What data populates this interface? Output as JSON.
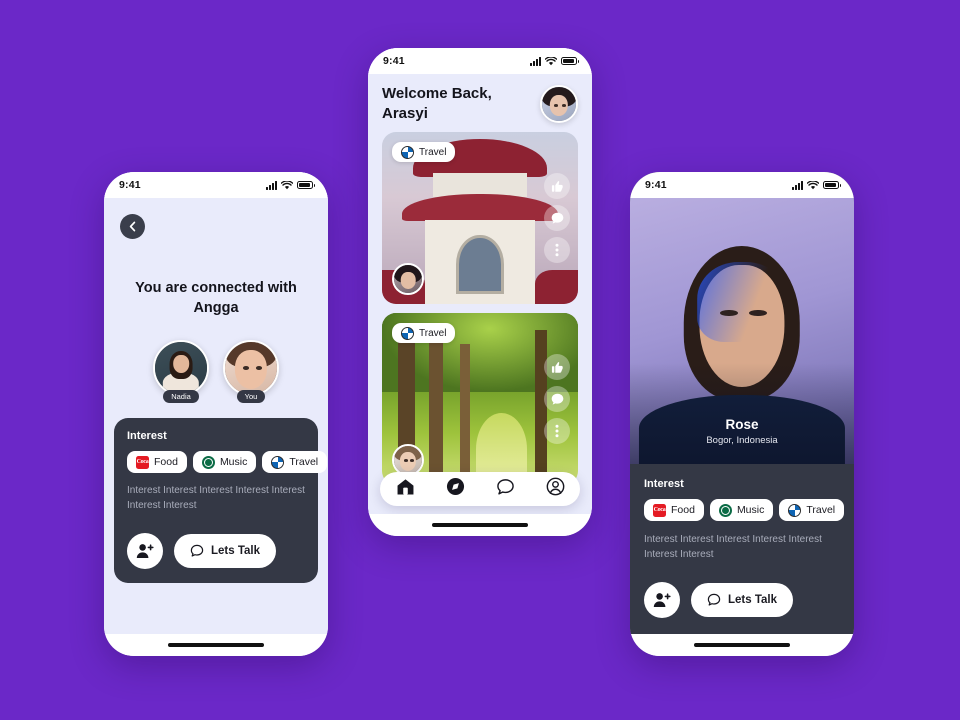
{
  "theme": {
    "background": "#6B28C8",
    "screen_bg": "#E9EBFB",
    "card_bg": "#343845",
    "chip_bg": "#FFFFFF",
    "text_dark": "#14141C",
    "text_muted": "#A9ADBB"
  },
  "status_bar": {
    "time": "9:41",
    "signal_icon": "signal-bars-icon",
    "wifi_icon": "wifi-icon",
    "battery_icon": "battery-icon"
  },
  "interest_card": {
    "title": "Interest",
    "chips": [
      {
        "label": "Food",
        "icon": "food-brand-icon"
      },
      {
        "label": "Music",
        "icon": "music-brand-icon"
      },
      {
        "label": "Travel",
        "icon": "travel-brand-icon"
      }
    ],
    "body": "Interest Interest Interest Interest Interest Interest Interest",
    "add_friend_icon": "add-person-icon",
    "talk_button": {
      "label": "Lets Talk",
      "icon": "chat-bubble-icon"
    }
  },
  "left_phone": {
    "back_icon": "chevron-left-icon",
    "title": "You are connected with Angga",
    "avatars": [
      {
        "tag": "Nadia",
        "name": "avatar-nadia"
      },
      {
        "tag": "You",
        "name": "avatar-you"
      }
    ]
  },
  "center_phone": {
    "greeting": "Welcome Back,",
    "username": "Arasyi",
    "profile_avatar": "header-avatar",
    "posts": [
      {
        "tag": {
          "label": "Travel",
          "icon": "travel-brand-icon"
        },
        "image": "pagoda-temple-photo",
        "avatar": "post-author-avatar",
        "actions": [
          {
            "name": "like-button",
            "icon": "thumbs-up-icon"
          },
          {
            "name": "comment-button",
            "icon": "comment-bubble-icon"
          },
          {
            "name": "more-button",
            "icon": "more-vertical-icon"
          }
        ]
      },
      {
        "tag": {
          "label": "Travel",
          "icon": "travel-brand-icon"
        },
        "image": "forest-path-photo",
        "avatar": "post-author-avatar",
        "actions": [
          {
            "name": "like-button",
            "icon": "thumbs-up-icon"
          },
          {
            "name": "comment-button",
            "icon": "comment-bubble-icon"
          },
          {
            "name": "more-button",
            "icon": "more-vertical-icon"
          }
        ]
      }
    ],
    "tabbar": [
      {
        "name": "tab-home",
        "icon": "home-icon",
        "active": true
      },
      {
        "name": "tab-explore",
        "icon": "compass-icon",
        "active": true
      },
      {
        "name": "tab-chat",
        "icon": "chat-icon",
        "active": false
      },
      {
        "name": "tab-profile",
        "icon": "person-icon",
        "active": false
      }
    ]
  },
  "right_phone": {
    "hero_image": "portrait-photo",
    "name": "Rose",
    "location": "Bogor, Indonesia"
  }
}
